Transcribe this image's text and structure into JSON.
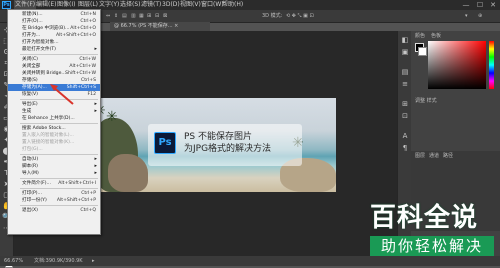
{
  "menubar": {
    "ps_logo": "Ps",
    "items": [
      "文件(F)",
      "编辑(E)",
      "图像(I)",
      "图层(L)",
      "文字(Y)",
      "选择(S)",
      "滤镜(T)",
      "3D(D)",
      "视图(V)",
      "窗口(W)",
      "帮助(H)"
    ],
    "window_controls": [
      "—",
      "☐",
      "✕"
    ]
  },
  "optionsbar": {
    "items": [
      "⇔",
      "⇕",
      "▤",
      "▥",
      "▦",
      "⊞",
      "⊟",
      "⊠",
      "3D 模式:",
      "⟲ ✥ ⤡ ▣ ⊡",
      "▾",
      "⊕"
    ]
  },
  "document_tab": {
    "label": "@ 66.7% (PS 不能保存... ×"
  },
  "file_menu": {
    "items": [
      {
        "label": "新建(N)...",
        "shortcut": "Ctrl+N"
      },
      {
        "label": "打开(O)...",
        "shortcut": "Ctrl+O"
      },
      {
        "label": "在 Bridge 中浏览(B)...",
        "shortcut": "Alt+Ctrl+O"
      },
      {
        "label": "打开为...",
        "shortcut": "Alt+Shift+Ctrl+O"
      },
      {
        "label": "打开为智能对象...",
        "shortcut": ""
      },
      {
        "label": "最近打开文件(T)",
        "shortcut": "",
        "submenu": true
      },
      {
        "sep": true
      },
      {
        "label": "关闭(C)",
        "shortcut": "Ctrl+W"
      },
      {
        "label": "关闭全部",
        "shortcut": "Alt+Ctrl+W"
      },
      {
        "label": "关闭并转到 Bridge...",
        "shortcut": "Shift+Ctrl+W"
      },
      {
        "label": "存储(S)",
        "shortcut": "Ctrl+S"
      },
      {
        "label": "存储为(A)...",
        "shortcut": "Shift+Ctrl+S",
        "highlighted": true
      },
      {
        "label": "恢复(V)",
        "shortcut": "F12"
      },
      {
        "sep": true
      },
      {
        "label": "导出(E)",
        "shortcut": "",
        "submenu": true
      },
      {
        "label": "生成",
        "shortcut": "",
        "submenu": true
      },
      {
        "label": "在 Behance 上共享(D)...",
        "shortcut": ""
      },
      {
        "sep": true
      },
      {
        "label": "搜索 Adobe Stock...",
        "shortcut": ""
      },
      {
        "label": "置入嵌入的智能对象(L)...",
        "shortcut": "",
        "disabled": true
      },
      {
        "label": "置入链接的智能对象(K)...",
        "shortcut": "",
        "disabled": true
      },
      {
        "label": "打包(G)...",
        "shortcut": "",
        "disabled": true
      },
      {
        "sep": true
      },
      {
        "label": "自动(U)",
        "shortcut": "",
        "submenu": true
      },
      {
        "label": "脚本(R)",
        "shortcut": "",
        "submenu": true
      },
      {
        "label": "导入(M)",
        "shortcut": "",
        "submenu": true
      },
      {
        "sep": true
      },
      {
        "label": "文件简介(F)...",
        "shortcut": "Alt+Shift+Ctrl+I"
      },
      {
        "sep": true
      },
      {
        "label": "打印(P)...",
        "shortcut": "Ctrl+P"
      },
      {
        "label": "打印一份(Y)",
        "shortcut": "Alt+Shift+Ctrl+P"
      },
      {
        "sep": true
      },
      {
        "label": "退出(X)",
        "shortcut": "Ctrl+Q"
      }
    ]
  },
  "image_overlay": {
    "badge": "Ps",
    "line1": "PS 不能保存图片",
    "line2": "为JPG格式的解决方法"
  },
  "toolbar": {
    "tools": [
      "⊹",
      "⬚",
      "ʘ",
      "⌗",
      "⊡",
      "✎",
      "⌁",
      "✐",
      "▭",
      "◉",
      "✦",
      "⬤",
      "✒",
      "T",
      "➤",
      "▢",
      "✋",
      "🔍",
      "⋯"
    ]
  },
  "side_icons": [
    "◧",
    "▣",
    "▤",
    "≡",
    "⊞",
    "⊡",
    "A",
    "¶"
  ],
  "panels": {
    "color_tabs": [
      "颜色",
      "色板"
    ],
    "properties_label": "调整 样式",
    "layers_tabs": [
      "图层",
      "通道",
      "路径"
    ]
  },
  "statusbar": {
    "zoom": "66.67%",
    "doc_info": "文档:390.9K/390.9K",
    "arrow": "▸"
  },
  "watermark": {
    "top": "百科全说",
    "bottom": "助你轻松解决"
  },
  "colors": {
    "highlight": "#3a7bd5",
    "arrow": "#d9342b",
    "watermark_green": "#1a9a55",
    "ps_blue": "#31a8ff"
  }
}
